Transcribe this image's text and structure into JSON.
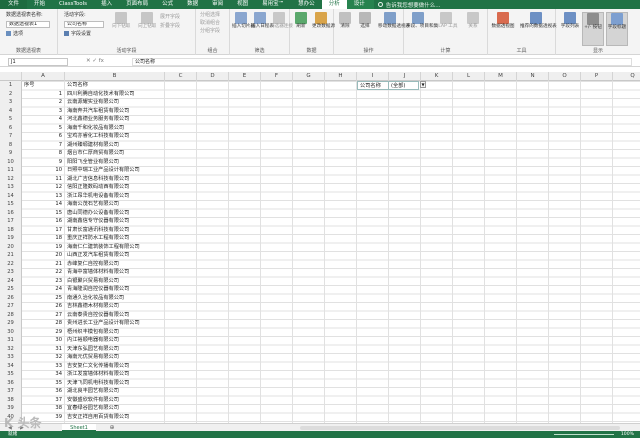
{
  "tabs": [
    "文件",
    "开始",
    "ClassTools",
    "插入",
    "页面布局",
    "公式",
    "数据",
    "审阅",
    "视图",
    "易用宝™",
    "慧办公",
    "分析",
    "设计"
  ],
  "tell_me": "告诉我您想要做什么...",
  "ribbon": {
    "pivot": {
      "name_label": "数据透视表名称:",
      "name_value": "数据透视表1",
      "options": "选项",
      "group": "数据透视表"
    },
    "active_field": {
      "label": "活动字段:",
      "value": "公司名称",
      "settings": "字段设置",
      "drill_down": "向下钻取",
      "drill_up": "向上钻取",
      "expand": "展开字段",
      "collapse": "折叠字段",
      "group": "活动字段"
    },
    "grouping": {
      "sel": "分组选择",
      "ungroup": "取消组合",
      "field": "分组字段",
      "group": "组合"
    },
    "filter": {
      "slicer": "插入切片器",
      "timeline": "插入日程表",
      "conn": "筛选器连接",
      "group": "筛选"
    },
    "data": {
      "refresh": "刷新",
      "change": "更改数据源",
      "group": "数据"
    },
    "actions": {
      "clear": "清除",
      "select": "选择",
      "move": "移动数据透视表",
      "group": "操作"
    },
    "calc": {
      "fields": "字段、项目和集",
      "olap": "OLAP 工具",
      "rel": "关系",
      "group": "计算"
    },
    "tools": {
      "chart": "数据透视图",
      "rec": "推荐的数据透视表",
      "group": "工具"
    },
    "show": {
      "list": "字段列表",
      "buttons": "+/- 按钮",
      "headers": "字段标题",
      "group": "显示"
    }
  },
  "name_box": "J1",
  "formula": "公司名称",
  "columns": [
    "A",
    "B",
    "C",
    "D",
    "E",
    "F",
    "G",
    "H",
    "I",
    "J",
    "K",
    "L",
    "M",
    "N",
    "O",
    "P",
    "Q"
  ],
  "header_row": {
    "a": "序号",
    "b": "公司名称"
  },
  "pivot_filter": {
    "field": "公司名称",
    "value": "(全部)"
  },
  "rows": [
    [
      "1",
      "四川利腾自动化技术有限公司"
    ],
    [
      "2",
      "云南源耀实业有限公司"
    ],
    [
      "3",
      "海南奔共汽车租赁有限公司"
    ],
    [
      "4",
      "河北鑫德业务服务有限公司"
    ],
    [
      "5",
      "海南千和化妆品有限公司"
    ],
    [
      "6",
      "宝鸡亦睿化工科技有限公司"
    ],
    [
      "7",
      "湖州臻塬建材有限公司"
    ],
    [
      "8",
      "烟台市仁厚商贸有限公司"
    ],
    [
      "9",
      "阳阳飞全管业有限公司"
    ],
    [
      "10",
      "日照中瑞工业产品设计有限公司"
    ],
    [
      "11",
      "湖北广吉信息科技有限公司"
    ],
    [
      "12",
      "信阳正隆数码动西有限公司"
    ],
    [
      "13",
      "浙江昂华机电设备有限公司"
    ],
    [
      "14",
      "海南公茂石艺有限公司"
    ],
    [
      "15",
      "唐山同德办公设备有限公司"
    ],
    [
      "16",
      "湖南鑫信专守仪器有限公司"
    ],
    [
      "17",
      "甘肃长富通讯科技有限公司"
    ],
    [
      "18",
      "重庆正祥防水工程有限公司"
    ],
    [
      "19",
      "海南仁仁建筑装饰工程有限公司"
    ],
    [
      "20",
      "山西正发汽车租赁有限公司"
    ],
    [
      "21",
      "赤峰复仁自控有限公司"
    ],
    [
      "22",
      "青海中富墙体材料有限公司"
    ],
    [
      "23",
      "白银聚兴贸易有限公司"
    ],
    [
      "24",
      "青海隆润自控仪器有限公司"
    ],
    [
      "25",
      "南通久治化妆品有限公司"
    ],
    [
      "26",
      "吉林鑫德木材有限公司"
    ],
    [
      "27",
      "云南泰贵自控仪器有限公司"
    ],
    [
      "28",
      "贵州进长工业产品设计有限公司"
    ],
    [
      "29",
      "梧州织丰模包有限公司"
    ],
    [
      "30",
      "内江裕顺电器有限公司"
    ],
    [
      "31",
      "天津东弘园艺有限公司"
    ],
    [
      "32",
      "海南元优贸易有限公司"
    ],
    [
      "33",
      "吉安复仁文化传播有限公司"
    ],
    [
      "34",
      "浙江发富墙体材料有限公司"
    ],
    [
      "35",
      "天津飞同机电科技有限公司"
    ],
    [
      "36",
      "湖北良丰园艺有限公司"
    ],
    [
      "37",
      "安徽盛欣软件有限公司"
    ],
    [
      "38",
      "宜春绿谷园艺有限公司"
    ],
    [
      "39",
      "吉安正祥自用百货有限公司"
    ],
    [
      "40",
      "益阳生源模具有限公司"
    ]
  ],
  "sheet_tab": "Sheet1",
  "status": "就绪",
  "zoom": "100%",
  "watermark": "K 头条"
}
